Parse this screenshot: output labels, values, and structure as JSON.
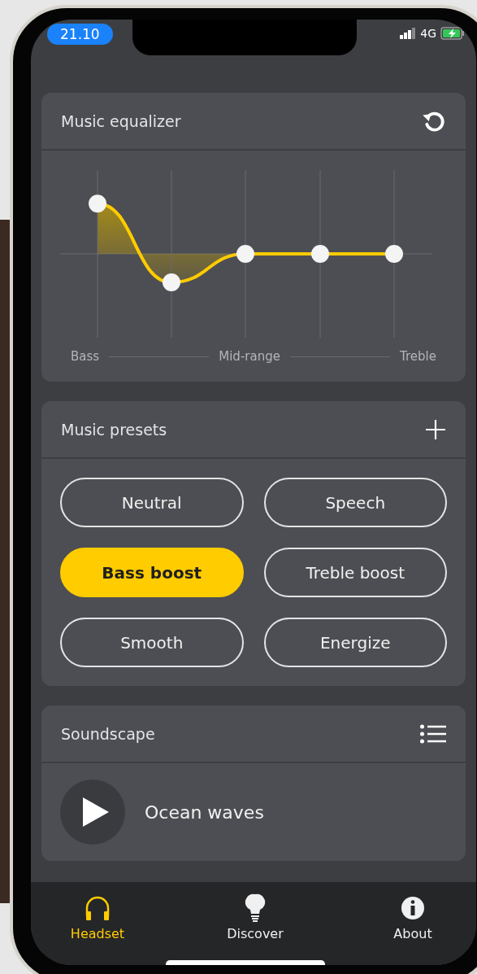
{
  "status_bar": {
    "time": "21.10",
    "network": "4G"
  },
  "equalizer": {
    "title": "Music equalizer",
    "bands": [
      {
        "level": 0.8
      },
      {
        "level": 0.33
      },
      {
        "level": 0.5
      },
      {
        "level": 0.5
      },
      {
        "level": 0.5
      }
    ],
    "axis_labels": [
      "Bass",
      "Mid-range",
      "Treble"
    ]
  },
  "presets": {
    "title": "Music presets",
    "items": [
      {
        "label": "Neutral",
        "selected": false
      },
      {
        "label": "Speech",
        "selected": false
      },
      {
        "label": "Bass boost",
        "selected": true
      },
      {
        "label": "Treble boost",
        "selected": false
      },
      {
        "label": "Smooth",
        "selected": false
      },
      {
        "label": "Energize",
        "selected": false
      }
    ]
  },
  "soundscape": {
    "title": "Soundscape",
    "track": "Ocean waves"
  },
  "tabs": [
    {
      "label": "Headset",
      "kind": "headset",
      "selected": true
    },
    {
      "label": "Discover",
      "kind": "discover",
      "selected": false
    },
    {
      "label": "About",
      "kind": "about",
      "selected": false
    }
  ]
}
